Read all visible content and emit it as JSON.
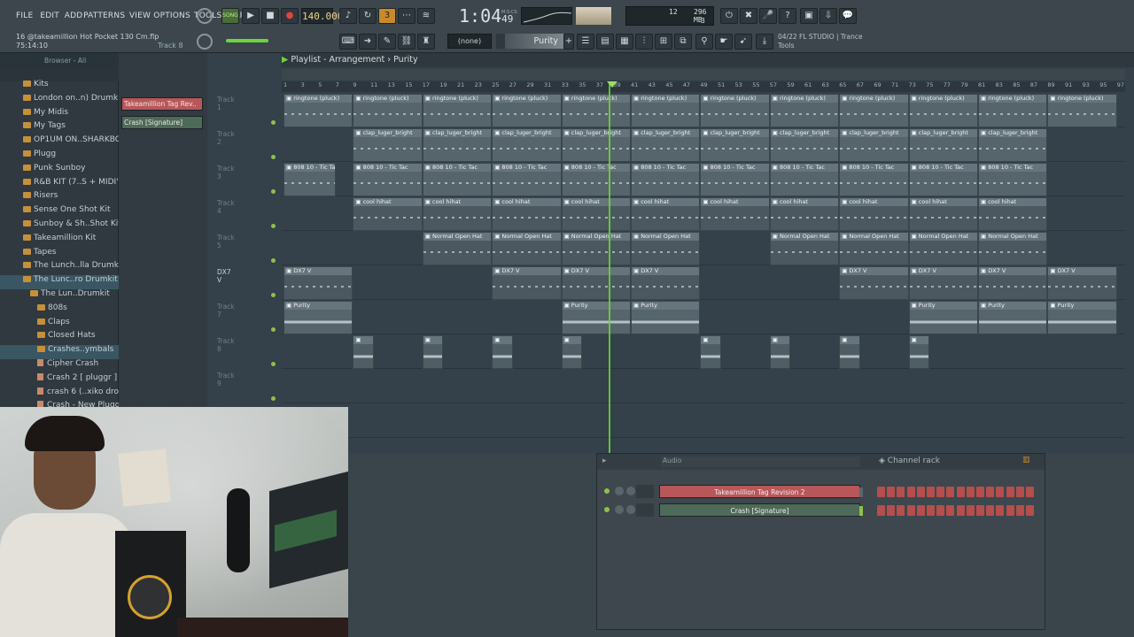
{
  "menu": [
    "FILE",
    "EDIT",
    "ADD",
    "PATTERNS",
    "VIEW",
    "OPTIONS",
    "TOOLS",
    "HELP"
  ],
  "transport": {
    "song_label": "SONG",
    "pat_label": "PAT",
    "tempo": "140.000",
    "clock": "1:04",
    "clock_sub": "49",
    "mcs": "M:S:CS",
    "cpu_num": "12",
    "mem": "296 MB",
    "poly": "3"
  },
  "project": {
    "name": "16 @takeamillion Hot Pocket 130 Cm.flp",
    "time": "75:14:10",
    "track": "Track 8"
  },
  "toolbar": {
    "pattern_none": "(none)",
    "pattern_name": "Purity",
    "hint_date": "04/22",
    "hint_line1": "FL STUDIO | Trance",
    "hint_line2": "Tools"
  },
  "browser": {
    "title": "Browser - All",
    "items": [
      {
        "label": "Kits",
        "type": "folder",
        "indent": 0
      },
      {
        "label": "London on..n) Drumkit",
        "type": "folder",
        "indent": 0
      },
      {
        "label": "My Midis",
        "type": "folder",
        "indent": 0
      },
      {
        "label": "My Tags",
        "type": "folder",
        "indent": 0
      },
      {
        "label": "OP1UM ON..SHARKBOY",
        "type": "folder",
        "indent": 0
      },
      {
        "label": "Plugg",
        "type": "folder",
        "indent": 0
      },
      {
        "label": "Punk Sunboy",
        "type": "folder",
        "indent": 0
      },
      {
        "label": "R&B KIT (7..S + MIDI's)",
        "type": "folder",
        "indent": 0
      },
      {
        "label": "Risers",
        "type": "folder",
        "indent": 0
      },
      {
        "label": "Sense One Shot Kit",
        "type": "folder",
        "indent": 0
      },
      {
        "label": "Sunboy & Sh..Shot Kit)",
        "type": "folder",
        "indent": 0
      },
      {
        "label": "Takeamillion Kit",
        "type": "folder",
        "indent": 0
      },
      {
        "label": "Tapes",
        "type": "folder",
        "indent": 0
      },
      {
        "label": "The Lunch..lla Drumkit",
        "type": "folder",
        "indent": 0
      },
      {
        "label": "The Lunc..ro Drumkit",
        "type": "folder",
        "indent": 0,
        "selected": true
      },
      {
        "label": "The Lun..Drumkit",
        "type": "folder",
        "indent": 1
      },
      {
        "label": "808s",
        "type": "folder",
        "indent": 2
      },
      {
        "label": "Claps",
        "type": "folder",
        "indent": 2
      },
      {
        "label": "Closed Hats",
        "type": "folder",
        "indent": 2
      },
      {
        "label": "Crashes..ymbals",
        "type": "folder",
        "indent": 2,
        "selected": true
      },
      {
        "label": "Cipher Crash",
        "type": "file",
        "indent": 2
      },
      {
        "label": "Crash 2 [ pluggr ]",
        "type": "file",
        "indent": 2
      },
      {
        "label": "crash 6 (..xiko dro)",
        "type": "file",
        "indent": 2
      },
      {
        "label": "Crash - New Plugg",
        "type": "file",
        "indent": 2
      }
    ]
  },
  "picker": [
    {
      "label": "Takeamillion Tag Rev..",
      "color": "#b8575a"
    },
    {
      "label": "Crash [Signature]",
      "color": "#4e6a58"
    }
  ],
  "playlist": {
    "title": "Playlist - Arrangement",
    "pattern": "Purity",
    "ruler": [
      "1",
      "3",
      "5",
      "7",
      "9",
      "11",
      "13",
      "15",
      "17",
      "19",
      "21",
      "23",
      "25",
      "27",
      "29",
      "31",
      "33",
      "35",
      "37",
      "39",
      "41",
      "43",
      "45",
      "47",
      "49",
      "51",
      "53",
      "55",
      "57",
      "59",
      "61",
      "63",
      "65",
      "67",
      "69",
      "71",
      "73",
      "75",
      "77",
      "79",
      "81",
      "83",
      "85",
      "87",
      "89",
      "91",
      "93",
      "95",
      "97"
    ],
    "tracks": [
      "Track 1",
      "Track 2",
      "Track 3",
      "Track 4",
      "Track 5",
      "DX7 V",
      "Track 7",
      "Track 8",
      "Track 9",
      "Track 10"
    ],
    "clip_ringtone": "ringtone (pluck)",
    "clip_clap": "clap_luger_bright",
    "clip_808": "808 10 - Tic Tac",
    "clip_hihat": "cool hihat",
    "clip_openhat": "Normal Open Hat",
    "clip_dx7": "DX7 V",
    "clip_purity": "Purity"
  },
  "channel_rack": {
    "filter": "Audio",
    "title": "Channel rack",
    "channels": [
      {
        "name": "Takeamillion Tag Revision 2",
        "color": "#b8575a"
      },
      {
        "name": "Crash [Signature]",
        "color": "#4e6a58"
      }
    ]
  }
}
